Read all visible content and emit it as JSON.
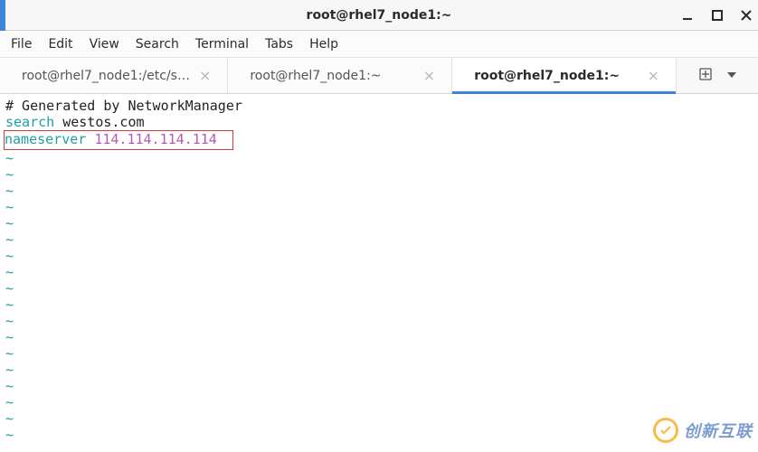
{
  "window": {
    "title": "root@rhel7_node1:~"
  },
  "menubar": {
    "items": [
      "File",
      "Edit",
      "View",
      "Search",
      "Terminal",
      "Tabs",
      "Help"
    ]
  },
  "tabs": {
    "items": [
      {
        "label": "root@rhel7_node1:/etc/s…",
        "active": false
      },
      {
        "label": "root@rhel7_node1:~",
        "active": false
      },
      {
        "label": "root@rhel7_node1:~",
        "active": true
      }
    ]
  },
  "editor": {
    "comment": "# Generated by NetworkManager",
    "search_kw": "search",
    "search_arg": " westos.com",
    "ns_kw": "nameserver ",
    "ns_ip": "114.114.114.114",
    "tilde": "~",
    "tilde_count": 18
  },
  "watermark": {
    "text": "创新互联"
  }
}
